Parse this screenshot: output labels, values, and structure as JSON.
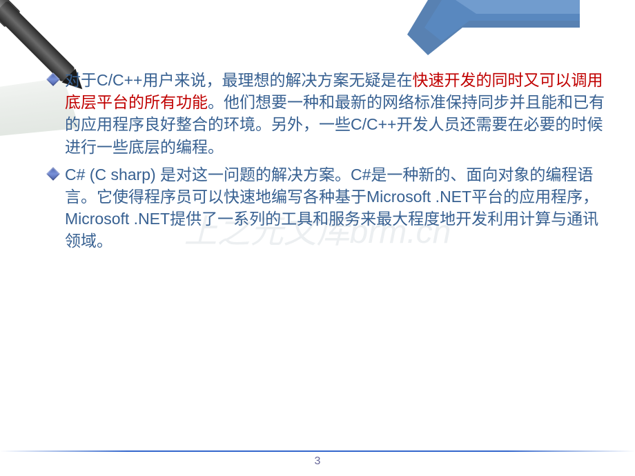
{
  "bullets": [
    {
      "prefix": "对于C/C++用户来说，最理想的解决方案无疑是在",
      "highlight": "快速开发的同时又可以调用底层平台的所有功能",
      "suffix": "。他们想要一种和最新的网络标准保持同步并且能和已有的应用程序良好整合的环境。另外，一些C/C++开发人员还需要在必要的时候进行一些底层的编程。"
    },
    {
      "text": "C# (C sharp) 是对这一问题的解决方案。C#是一种新的、面向对象的编程语言。它使得程序员可以快速地编写各种基于Microsoft .NET平台的应用程序，Microsoft .NET提供了一系列的工具和服务来最大程度地开发利用计算与通讯领域。"
    }
  ],
  "watermark": "上之元文库brm.cn",
  "pageNumber": "3"
}
